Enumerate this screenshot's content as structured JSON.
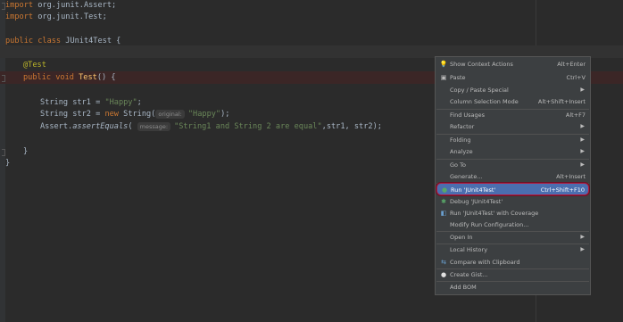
{
  "editor": {
    "lines": [
      {
        "kw": "import",
        "rest": " org.junit.Assert;"
      },
      {
        "kw": "import",
        "rest": " org.junit.Test;"
      },
      {
        "kw": "public class",
        "rest": " JUnit4Test {"
      },
      {
        "ann": "@Test"
      },
      {
        "kw": "public void",
        "mth": "Test",
        "rest": "() {"
      },
      {
        "plain": "String str1 = ",
        "str": "\"Happy\"",
        "rest": ";"
      },
      {
        "plain": "String str2 = ",
        "kw": "new",
        "plain2": " String(",
        "hint": "original:",
        "str": "\"Happy\"",
        "rest": ");"
      },
      {
        "plain": "Assert.",
        "ital": "assertEquals",
        "plain2": "( ",
        "hint": "message:",
        "str": "\"String1 and String 2 are equal\"",
        "rest": ",str1, str2);"
      },
      {
        "plain": "}"
      },
      {
        "plain": "}"
      }
    ]
  },
  "context_menu": {
    "items": [
      {
        "label": "Show Context Actions",
        "shortcut": "Alt+Enter",
        "icon": "bulb-icon"
      },
      {
        "label": "Paste",
        "shortcut": "Ctrl+V",
        "icon": "clipboard-icon"
      },
      {
        "label": "Copy / Paste Special",
        "submenu": true
      },
      {
        "label": "Column Selection Mode",
        "shortcut": "Alt+Shift+Insert"
      },
      {
        "label": "Find Usages",
        "shortcut": "Alt+F7"
      },
      {
        "label": "Refactor",
        "submenu": true
      },
      {
        "label": "Folding",
        "submenu": true
      },
      {
        "label": "Analyze",
        "submenu": true
      },
      {
        "label": "Go To",
        "submenu": true
      },
      {
        "label": "Generate...",
        "shortcut": "Alt+Insert"
      },
      {
        "label": "Run 'JUnit4Test'",
        "shortcut": "Ctrl+Shift+F10",
        "icon": "run-icon",
        "selected": true
      },
      {
        "label": "Debug 'JUnit4Test'",
        "icon": "debug-icon"
      },
      {
        "label": "Run 'JUnit4Test' with Coverage",
        "icon": "coverage-icon"
      },
      {
        "label": "Modify Run Configuration..."
      },
      {
        "label": "Open In",
        "submenu": true
      },
      {
        "label": "Local History",
        "submenu": true
      },
      {
        "label": "Compare with Clipboard",
        "icon": "compare-icon"
      },
      {
        "label": "Create Gist...",
        "icon": "github-icon"
      },
      {
        "label": "Add BOM"
      }
    ]
  }
}
